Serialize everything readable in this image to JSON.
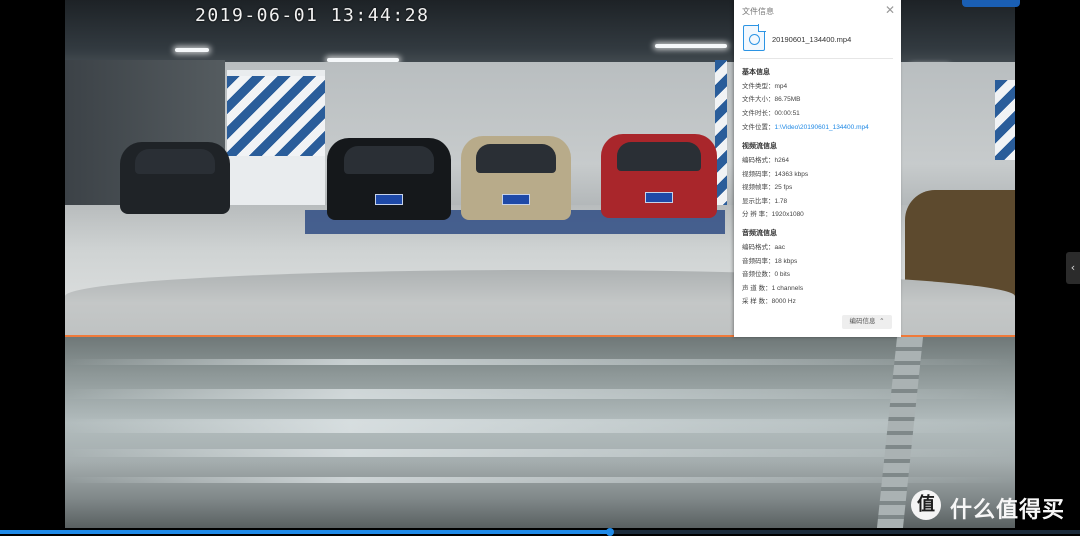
{
  "video": {
    "timestamp": "2019-06-01  13:44:28"
  },
  "player": {
    "progress_fraction": 0.565
  },
  "panel": {
    "title": "文件信息",
    "file_name": "20190601_134400.mp4",
    "basic_title": "基本信息",
    "basic_rows": [
      {
        "label": "文件类型：",
        "value": "mp4"
      },
      {
        "label": "文件大小：",
        "value": "86.75MB"
      },
      {
        "label": "文件时长：",
        "value": "00:00:51"
      },
      {
        "label": "文件位置：",
        "value": "1:\\Video\\20190601_134400.mp4"
      }
    ],
    "video_title": "视频流信息",
    "video_rows": [
      {
        "label": "编码格式：",
        "value": "h264"
      },
      {
        "label": "视频码率：",
        "value": "14363 kbps"
      },
      {
        "label": "视频帧率：",
        "value": "25 fps"
      },
      {
        "label": "显示比率：",
        "value": "1.78"
      },
      {
        "label": "分 辨 率：",
        "value": "1920x1080"
      }
    ],
    "audio_title": "音频流信息",
    "audio_rows": [
      {
        "label": "编码格式：",
        "value": "aac"
      },
      {
        "label": "音频码率：",
        "value": "18 kbps"
      },
      {
        "label": "音频位数：",
        "value": "0 bits"
      },
      {
        "label": "声 道 数：",
        "value": "1 channels"
      },
      {
        "label": "采 样 数：",
        "value": "8000 Hz"
      }
    ],
    "codec_button": "编码信息"
  },
  "watermark": {
    "logo": "值",
    "text": "什么值得买"
  },
  "icons": {
    "close": "close-icon",
    "file": "video-file-icon",
    "chevron": "chevron-up-icon",
    "side": "chevron-left-icon"
  },
  "colors": {
    "accent": "#1f8ae8",
    "link": "#1e88e5",
    "divider_line": "#f07a3a"
  }
}
